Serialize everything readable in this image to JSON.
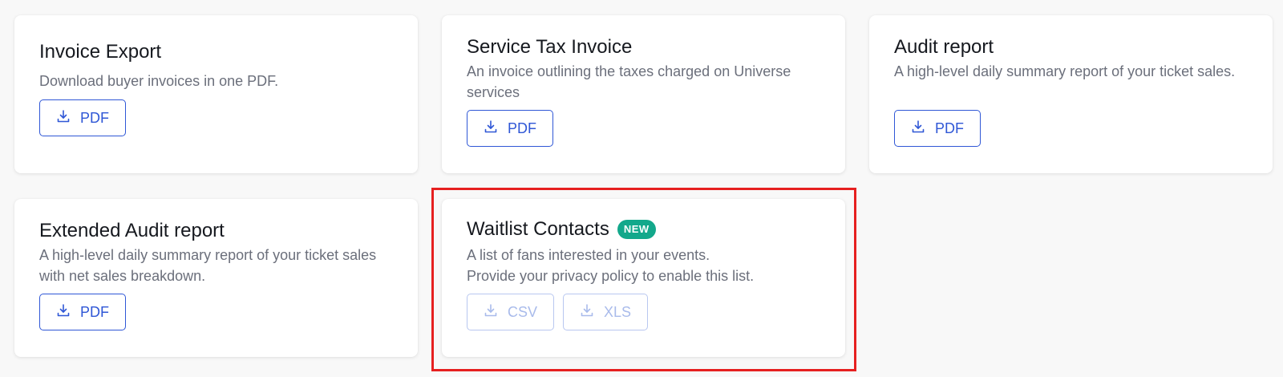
{
  "cards": {
    "invoice_export": {
      "title": "Invoice Export",
      "description": "Download buyer invoices in one PDF.",
      "buttons": [
        {
          "label": "PDF",
          "icon": "download-icon"
        }
      ]
    },
    "service_tax": {
      "title": "Service Tax Invoice",
      "description": "An invoice outlining the taxes charged on Universe services",
      "buttons": [
        {
          "label": "PDF",
          "icon": "download-icon"
        }
      ]
    },
    "audit_report": {
      "title": "Audit report",
      "description": "A high-level daily summary report of your ticket sales.",
      "buttons": [
        {
          "label": "PDF",
          "icon": "download-icon"
        }
      ]
    },
    "extended_audit": {
      "title": "Extended Audit report",
      "description": "A high-level daily summary report of your ticket sales with net sales breakdown.",
      "buttons": [
        {
          "label": "PDF",
          "icon": "download-icon"
        }
      ]
    },
    "waitlist": {
      "title": "Waitlist Contacts",
      "badge": "NEW",
      "description_line1": "A list of fans interested in your events.",
      "description_line2": "Provide your privacy policy to enable this list.",
      "buttons": [
        {
          "label": "CSV",
          "icon": "download-icon",
          "disabled": true
        },
        {
          "label": "XLS",
          "icon": "download-icon",
          "disabled": true
        }
      ]
    }
  },
  "colors": {
    "accent": "#2f57d6",
    "accent_disabled": "#b8c7f0",
    "badge": "#13a88b",
    "highlight": "#e62020",
    "background": "#f8f8f8"
  }
}
